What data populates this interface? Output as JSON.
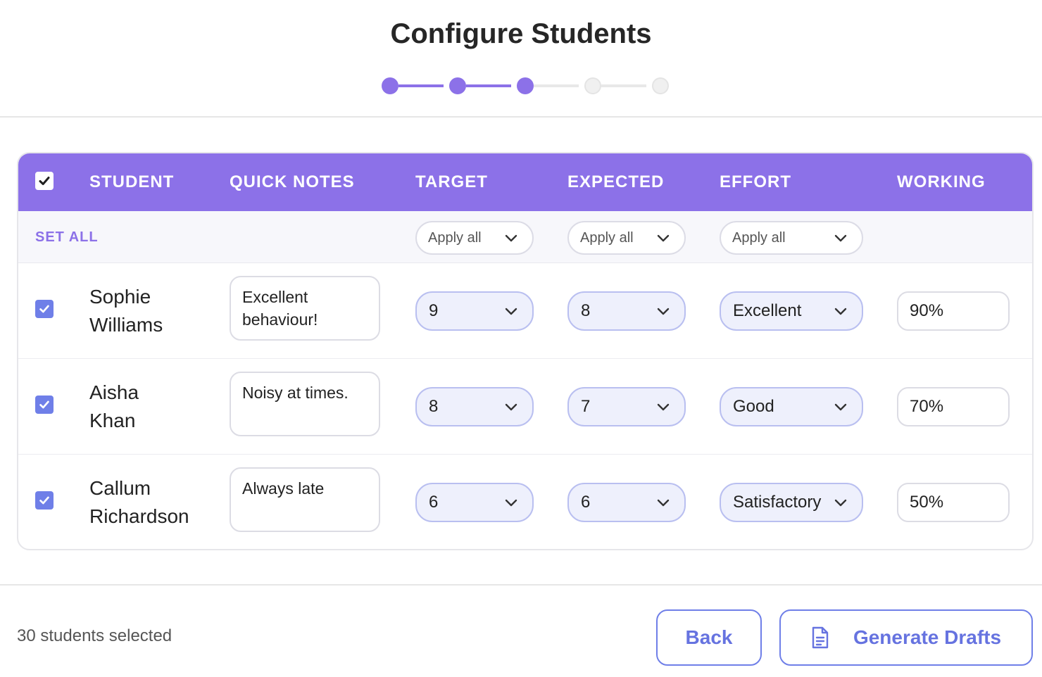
{
  "page": {
    "title": "Configure Students",
    "stepper": {
      "total_steps": 5,
      "completed_steps": 3
    }
  },
  "colors": {
    "accent": "#8c71e8",
    "checkbox": "#6f7fe8",
    "button_text": "#6673e0",
    "select_bg": "#eef0fc",
    "inactive_step": "#e8e8e8"
  },
  "table": {
    "columns": [
      "STUDENT",
      "QUICK NOTES",
      "TARGET",
      "EXPECTED",
      "EFFORT",
      "WORKING"
    ],
    "header_checked": true,
    "set_all": {
      "label": "SET ALL",
      "target": "Apply all",
      "expected": "Apply all",
      "effort": "Apply all"
    },
    "rows": [
      {
        "checked": true,
        "first_name": "Sophie",
        "last_name": "Williams",
        "notes": "Excellent behaviour!",
        "target": "9",
        "expected": "8",
        "effort": "Excellent",
        "working": "90%"
      },
      {
        "checked": true,
        "first_name": "Aisha",
        "last_name": "Khan",
        "notes": "Noisy at times.",
        "target": "8",
        "expected": "7",
        "effort": "Good",
        "working": "70%"
      },
      {
        "checked": true,
        "first_name": "Callum",
        "last_name": "Richardson",
        "notes": "Always late",
        "target": "6",
        "expected": "6",
        "effort": "Satisfactory",
        "working": "50%"
      }
    ]
  },
  "footer": {
    "selected_count": "30 students selected",
    "back_label": "Back",
    "generate_label": "Generate Drafts",
    "generate_icon": "document-icon"
  }
}
